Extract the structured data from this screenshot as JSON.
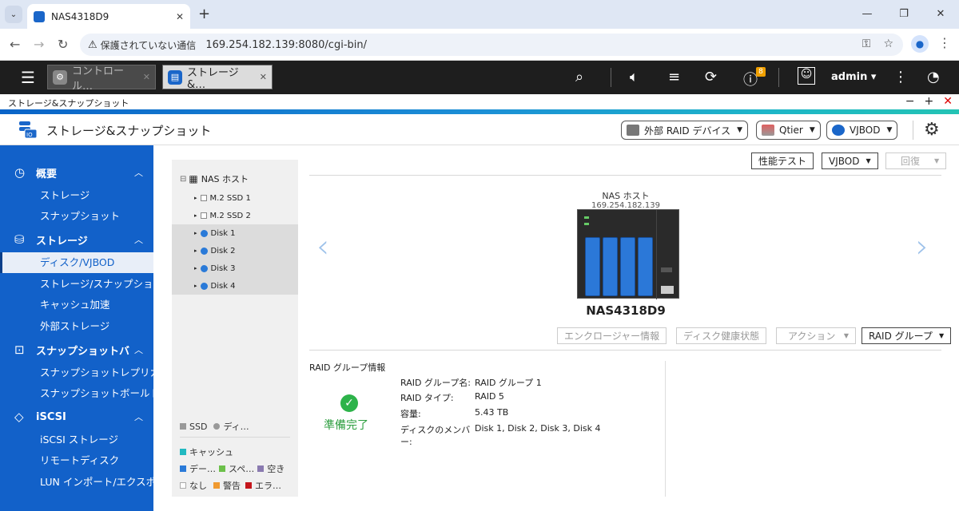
{
  "browser": {
    "tab_title": "NAS4318D9",
    "security_label": "保護されていない通信",
    "url": "169.254.182.139:8080/cgi-bin/"
  },
  "qts": {
    "tabs": [
      {
        "label": "コントロール…",
        "icon": "gear-icon"
      },
      {
        "label": "ストレージ&…",
        "icon": "storage-icon"
      }
    ],
    "notification_count": "8",
    "user": "admin ▾"
  },
  "window": {
    "strip_title": "ストレージ&スナップショット",
    "app_title": "ストレージ&スナップショット",
    "header_buttons": [
      {
        "label": "外部 RAID デバイス",
        "icon": "external-raid-icon"
      },
      {
        "label": "Qtier",
        "icon": "qtier-icon"
      },
      {
        "label": "VJBOD",
        "icon": "vjbod-icon"
      }
    ]
  },
  "sidebar": {
    "sections": [
      {
        "label": "概要",
        "icon": "dashboard-icon",
        "items": [
          "ストレージ",
          "スナップショット"
        ]
      },
      {
        "label": "ストレージ",
        "icon": "database-icon",
        "items": [
          "ディスク/VJBOD",
          "ストレージ/スナップショ",
          "キャッシュ加速",
          "外部ストレージ"
        ]
      },
      {
        "label": "スナップショットバ",
        "icon": "snapshot-icon",
        "items": [
          "スナップショットレプリカ",
          "スナップショットボールト"
        ]
      },
      {
        "label": "iSCSI",
        "icon": "iscsi-icon",
        "items": [
          "iSCSI ストレージ",
          "リモートディスク",
          "LUN インポート/エクスポ"
        ]
      }
    ],
    "active_item": "ディスク/VJBOD"
  },
  "tree": {
    "root": "NAS ホスト",
    "nodes": [
      "M.2 SSD 1",
      "M.2 SSD 2",
      "Disk 1",
      "Disk 2",
      "Disk 3",
      "Disk 4"
    ],
    "legend_type": [
      "SSD",
      "ディ…"
    ],
    "legend_cache": "キャッシュ",
    "legend_row1": [
      "デー…",
      "スペ…",
      "空き"
    ],
    "legend_row2": [
      "なし",
      "警告",
      "エラ…"
    ],
    "colors": {
      "data": "#2a7ad8",
      "spare": "#6cc04a",
      "free": "#8a7ab0",
      "cache": "#21b9c1",
      "warn": "#f09a30",
      "error": "#c4161c"
    }
  },
  "main": {
    "toolbar": {
      "perf": "性能テスト",
      "vjbod": "VJBOD",
      "recover": "回復"
    },
    "host_label": "NAS ホスト",
    "host_ip": "169.254.182.139",
    "nas_name": "NAS4318D9",
    "actions": {
      "enclosure": "エンクロージャー情報",
      "health": "ディスク健康状態",
      "action": "アクション",
      "raid": "RAID グループ"
    },
    "raid_info": {
      "title": "RAID グループ情報",
      "status": "準備完了",
      "name_label": "RAID グループ名:",
      "name_value": "RAID グループ 1",
      "type_label": "RAID タイプ:",
      "type_value": "RAID 5",
      "cap_label": "容量:",
      "cap_value": "5.43 TB",
      "mem_label_1": "ディスクのメンバ",
      "mem_label_2": "ー:",
      "mem_value": "Disk 1, Disk 2, Disk 3, Disk 4"
    }
  }
}
